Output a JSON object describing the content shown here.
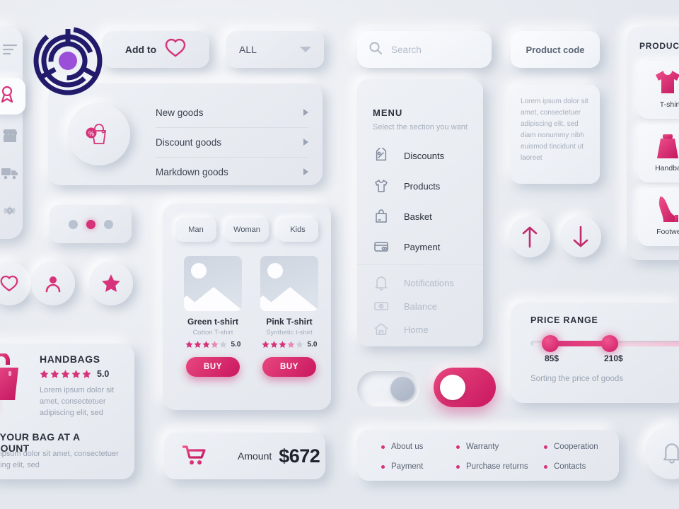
{
  "colors": {
    "background": "#eaedf2",
    "accent_pink": "#d6337a",
    "accent_pink_dark": "#c9175f",
    "text_dark": "#2b313c",
    "text_muted": "#a6aebc",
    "logo_navy": "#221b6b",
    "logo_purple": "#9b4fd8"
  },
  "sidebar": {
    "items": [
      {
        "name": "menu-list-icon",
        "active": false
      },
      {
        "name": "ribbon-icon",
        "active": true
      },
      {
        "name": "store-icon",
        "active": false
      },
      {
        "name": "delivery-truck-icon",
        "active": false
      },
      {
        "name": "gear-icon",
        "active": false
      }
    ]
  },
  "add_to_favorites": {
    "label": "Add to",
    "icon": "heart-icon"
  },
  "filter_dropdown": {
    "value": "ALL",
    "icon": "chevron-down-icon"
  },
  "goods_list": {
    "icon": "discount-bag-icon",
    "rows": [
      {
        "label": "New goods"
      },
      {
        "label": "Discount goods"
      },
      {
        "label": "Markdown goods"
      }
    ]
  },
  "pagination": {
    "dots": 3,
    "active_index": 1
  },
  "round_buttons": [
    {
      "name": "heart-icon"
    },
    {
      "name": "user-icon"
    },
    {
      "name": "star-icon"
    }
  ],
  "promo": {
    "title": "HANDBAGS",
    "stars": 5,
    "rating": "5.0",
    "description": "Lorem ipsum dolor sit amet, consectetuer adipiscing elit, sed",
    "cta": "GET YOUR BAG AT A DISCOUNT",
    "subtext": "Lorem ipsum dolor sit amet, consectetuer adipiscing elit, sed",
    "badge": "%"
  },
  "product_card": {
    "tabs": [
      {
        "label": "Man"
      },
      {
        "label": "Woman"
      },
      {
        "label": "Kids"
      }
    ],
    "items": [
      {
        "name": "Green t-shirt",
        "subtitle": "Cotton T-shirt",
        "rating": "5.0",
        "stars_filled": 4,
        "stars_total": 5,
        "buy_label": "BUY"
      },
      {
        "name": "Pink T-shirt",
        "subtitle": "Synthetic t-shirt",
        "rating": "5.0",
        "stars_filled": 4,
        "stars_total": 5,
        "buy_label": "BUY"
      }
    ]
  },
  "amount_bar": {
    "icon": "shopping-cart-icon",
    "label": "Amount",
    "value": "$672"
  },
  "search": {
    "placeholder": "Search",
    "icon": "search-icon"
  },
  "product_code_button": {
    "label": "Product code"
  },
  "menu": {
    "title": "MENU",
    "subtitle": "Select the section you want",
    "primary_items": [
      {
        "label": "Discounts",
        "icon": "tag-icon"
      },
      {
        "label": "Products",
        "icon": "tshirt-icon"
      },
      {
        "label": "Basket",
        "icon": "shopping-bag-icon"
      },
      {
        "label": "Payment",
        "icon": "credit-card-icon"
      }
    ],
    "secondary_items": [
      {
        "label": "Notifications",
        "icon": "bell-icon"
      },
      {
        "label": "Balance",
        "icon": "banknote-icon"
      },
      {
        "label": "Home",
        "icon": "home-icon"
      }
    ]
  },
  "toggles": [
    {
      "name": "toggle-off",
      "state": "off"
    },
    {
      "name": "toggle-on",
      "state": "on"
    }
  ],
  "footer_links": [
    {
      "label": "About us"
    },
    {
      "label": "Warranty"
    },
    {
      "label": "Cooperation"
    },
    {
      "label": "Payment"
    },
    {
      "label": "Purchase returns"
    },
    {
      "label": "Contacts"
    }
  ],
  "lorem_card": {
    "text": "Lorem ipsum dolor sit amet, consectetuer adipiscing elit, sed diam nonummy nibh euismod tincidunt ut laoreet"
  },
  "arrow_buttons": [
    {
      "name": "arrow-up-icon"
    },
    {
      "name": "arrow-down-icon"
    }
  ],
  "price_range": {
    "title": "PRICE RANGE",
    "min_label": "85$",
    "max_label": "210$",
    "subtitle": "Sorting the price of goods"
  },
  "right_panel": {
    "title": "PRODUCTS",
    "items": [
      {
        "label": "T-shirts",
        "icon": "tshirt-filled-icon"
      },
      {
        "label": "Handbags",
        "icon": "handbag-filled-icon"
      },
      {
        "label": "Footwear",
        "icon": "heel-shoe-icon"
      }
    ]
  },
  "bell_button": {
    "icon": "bell-icon"
  }
}
